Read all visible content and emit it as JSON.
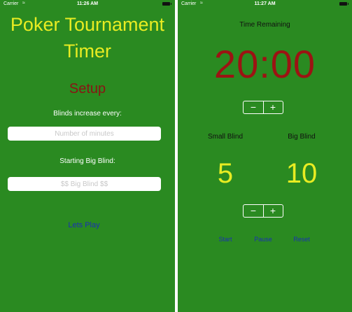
{
  "setup_screen": {
    "status": {
      "carrier": "Carrier",
      "time": "11:26 AM"
    },
    "title_line1": "Poker Tournament",
    "title_line2": "Timer",
    "setup_heading": "Setup",
    "blinds_label": "Blinds increase every:",
    "minutes_placeholder": "Number of minutes",
    "minutes_value": "",
    "big_blind_label": "Starting Big Blind:",
    "big_blind_placeholder": "$$ Big Blind $$",
    "big_blind_value": "",
    "play_button": "Lets Play"
  },
  "timer_screen": {
    "status": {
      "carrier": "Carrier",
      "time": "11:27 AM"
    },
    "time_remaining_label": "Time Remaining",
    "timer": "20:00",
    "small_blind_label": "Small Blind",
    "big_blind_label": "Big Blind",
    "small_blind_value": "5",
    "big_blind_value": "10",
    "start": "Start",
    "pause": "Pause",
    "reset": "Reset",
    "stepper_minus": "−",
    "stepper_plus": "+"
  },
  "colors": {
    "background": "#2a8a21",
    "title": "#e8ec22",
    "setup": "#8a1414",
    "timer": "#9c1313",
    "link": "#1a2fb5"
  },
  "icons": [
    "wifi-icon",
    "battery-icon",
    "minus-icon",
    "plus-icon"
  ]
}
